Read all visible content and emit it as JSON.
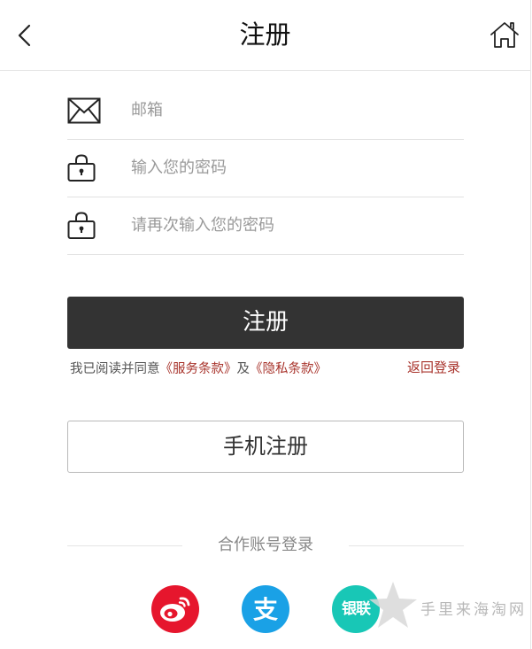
{
  "header": {
    "title": "注册",
    "back_icon": "chevron-left-icon",
    "home_icon": "home-icon"
  },
  "form": {
    "email": {
      "placeholder": "邮箱",
      "value": "",
      "icon": "mail-icon"
    },
    "password": {
      "placeholder": "输入您的密码",
      "value": "",
      "icon": "lock-icon"
    },
    "confirm_password": {
      "placeholder": "请再次输入您的密码",
      "value": "",
      "icon": "lock-icon"
    }
  },
  "register_button": "注册",
  "agreement": {
    "prefix": "我已阅读并同意",
    "terms_link": "《服务条款》",
    "middle": "及",
    "privacy_link": "《隐私条款》"
  },
  "back_to_login": "返回登录",
  "phone_register_button": "手机注册",
  "partner_login": {
    "label": "合作账号登录",
    "providers": [
      {
        "icon": "weibo-icon",
        "color": "#e6162d"
      },
      {
        "icon": "alipay-icon",
        "color": "#1aa1e6",
        "glyph": "支"
      },
      {
        "icon": "unionpay-icon",
        "color": "#18c7b6",
        "glyph": "银联"
      }
    ]
  },
  "watermark": {
    "text": "手里来海淘网",
    "icon": "star-icon"
  },
  "colors": {
    "primary_button": "#333333",
    "link": "#a8332b",
    "divider": "#e4e4e4"
  }
}
